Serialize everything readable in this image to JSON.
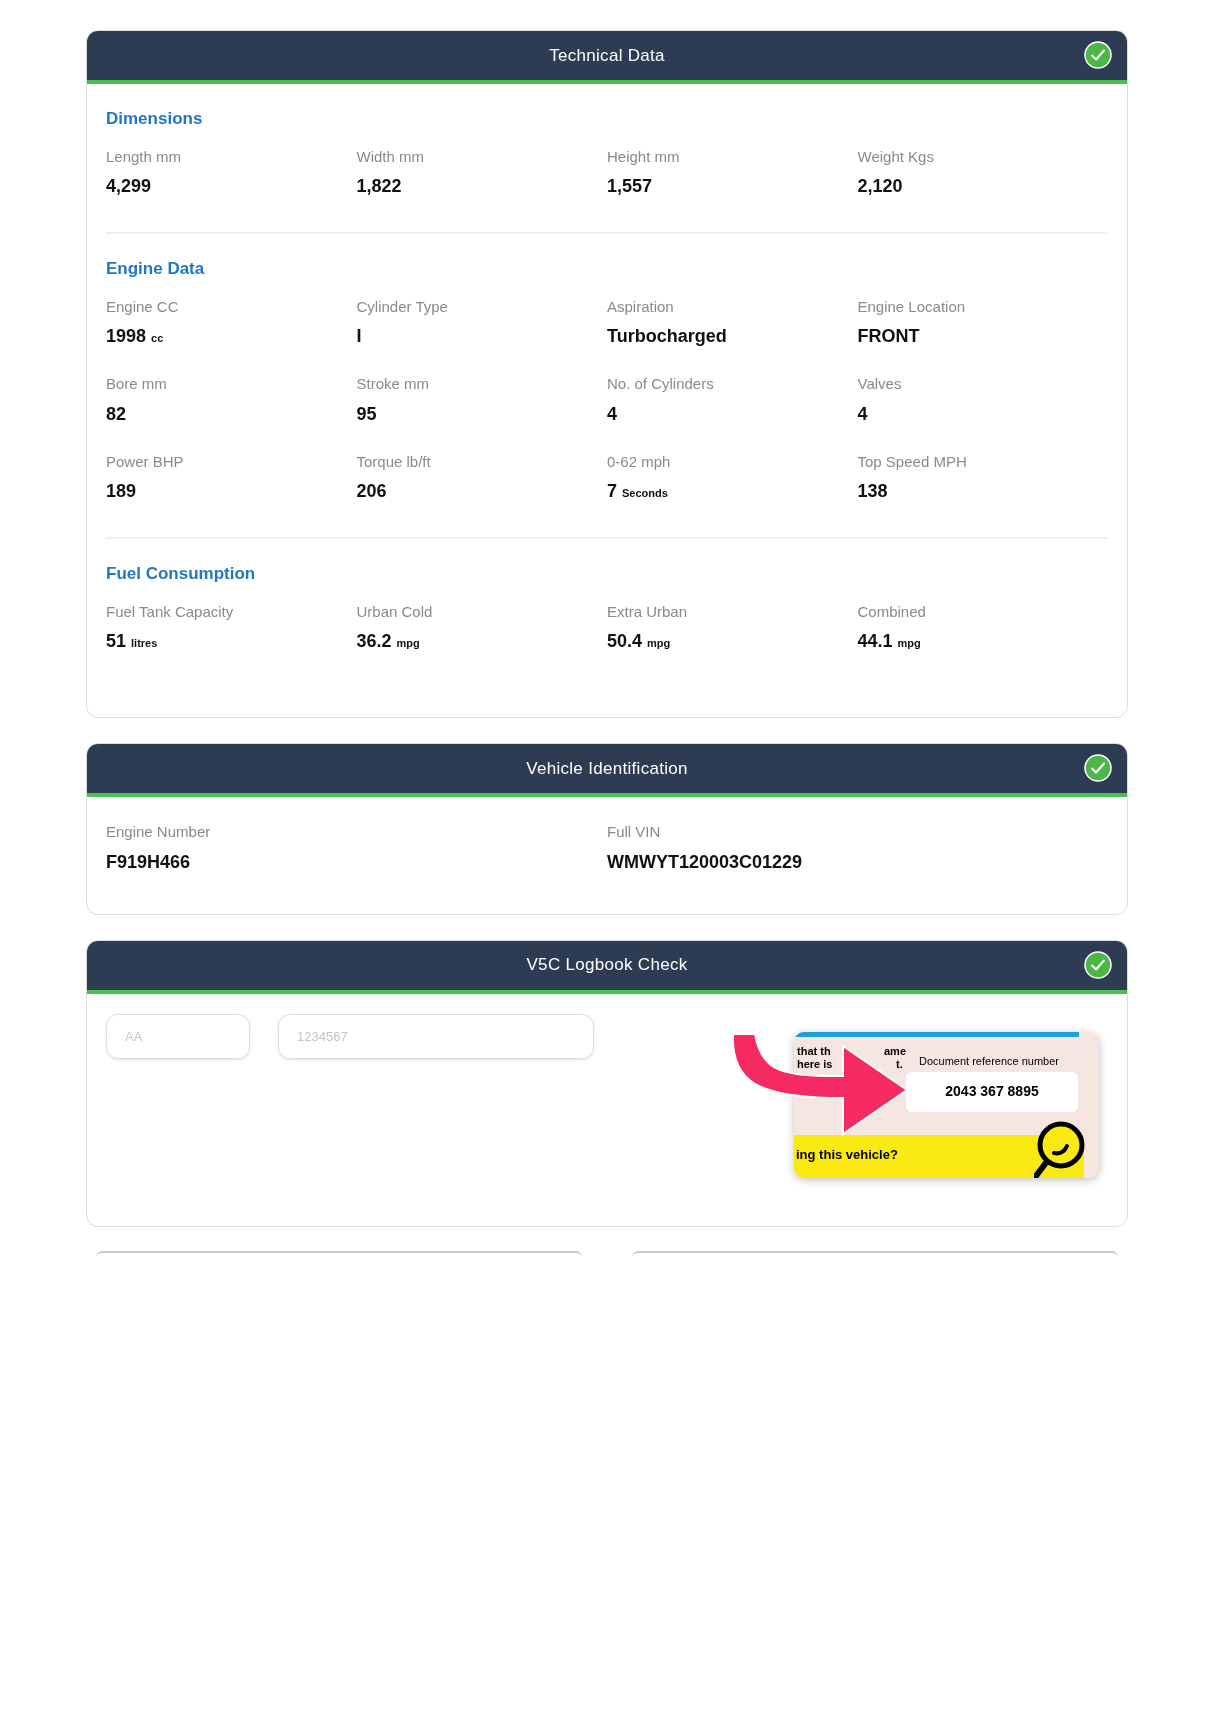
{
  "technical_data": {
    "title": "Technical Data",
    "verified": true,
    "groups": [
      {
        "heading": "Dimensions",
        "rows": [
          [
            {
              "label": "Length mm",
              "value": "4,299"
            },
            {
              "label": "Width mm",
              "value": "1,822"
            },
            {
              "label": "Height mm",
              "value": "1,557"
            },
            {
              "label": "Weight Kgs",
              "value": "2,120"
            }
          ]
        ]
      },
      {
        "heading": "Engine Data",
        "rows": [
          [
            {
              "label": "Engine CC",
              "value": "1998",
              "unit": "cc"
            },
            {
              "label": "Cylinder Type",
              "value": "I"
            },
            {
              "label": "Aspiration",
              "value": "Turbocharged"
            },
            {
              "label": "Engine Location",
              "value": "FRONT"
            }
          ],
          [
            {
              "label": "Bore mm",
              "value": "82"
            },
            {
              "label": "Stroke mm",
              "value": "95"
            },
            {
              "label": "No. of Cylinders",
              "value": "4"
            },
            {
              "label": "Valves",
              "value": "4"
            }
          ],
          [
            {
              "label": "Power BHP",
              "value": "189"
            },
            {
              "label": "Torque lb/ft",
              "value": "206"
            },
            {
              "label": "0-62 mph",
              "value": "7",
              "unit": "Seconds"
            },
            {
              "label": "Top Speed MPH",
              "value": "138"
            }
          ]
        ]
      },
      {
        "heading": "Fuel Consumption",
        "rows": [
          [
            {
              "label": "Fuel Tank Capacity",
              "value": "51",
              "unit": "litres"
            },
            {
              "label": "Urban Cold",
              "value": "36.2",
              "unit": "mpg"
            },
            {
              "label": "Extra Urban",
              "value": "50.4",
              "unit": "mpg"
            },
            {
              "label": "Combined",
              "value": "44.1",
              "unit": "mpg"
            }
          ]
        ]
      }
    ]
  },
  "vehicle_identification": {
    "title": "Vehicle Identification",
    "verified": true,
    "fields": [
      {
        "label": "Engine Number",
        "value": "F919H466"
      },
      {
        "label": "Full VIN",
        "value": "WMWYT120003C01229"
      }
    ]
  },
  "v5c_check": {
    "title": "V5C Logbook Check",
    "verified": true,
    "inputs": [
      {
        "placeholder": "AA"
      },
      {
        "placeholder": "1234567"
      }
    ],
    "illustration": {
      "fragments": [
        "that th",
        "ame",
        "here is",
        "t."
      ],
      "ref_label": "Document reference number",
      "ref_number": "2043 367 8895",
      "banner": "ing this vehicle?"
    }
  }
}
